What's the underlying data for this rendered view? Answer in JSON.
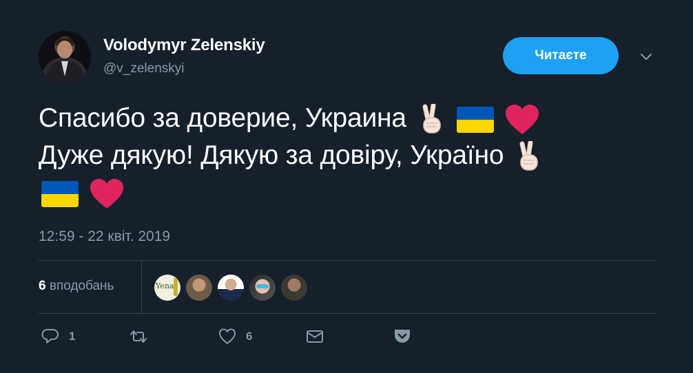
{
  "user": {
    "name": "Volodymyr Zelenskiy",
    "handle": "@v_zelenskyi"
  },
  "follow_button": {
    "label": "Читаєте"
  },
  "tweet": {
    "line1": "Спасибо за доверие, Украина",
    "line2": "Дуже дякую! Дякую за довіру, Україно",
    "timestamp": "12:59 - 22 квіт. 2019"
  },
  "likes": {
    "count": "6",
    "label": "вподобань"
  },
  "liker_avatars": [
    {
      "text": "Yena"
    }
  ],
  "actions": {
    "reply_count": "1",
    "retweet_count": "",
    "like_count": "6"
  },
  "colors": {
    "background": "#15202b",
    "accent": "#1da1f2",
    "muted": "#8899a6",
    "divider": "#38444d",
    "heart": "#e0245e"
  },
  "icons": [
    "chevron-down-icon",
    "victory-hand-icon",
    "ukraine-flag-icon",
    "red-heart-icon",
    "reply-icon",
    "retweet-icon",
    "like-icon",
    "direct-message-icon",
    "pocket-icon"
  ]
}
